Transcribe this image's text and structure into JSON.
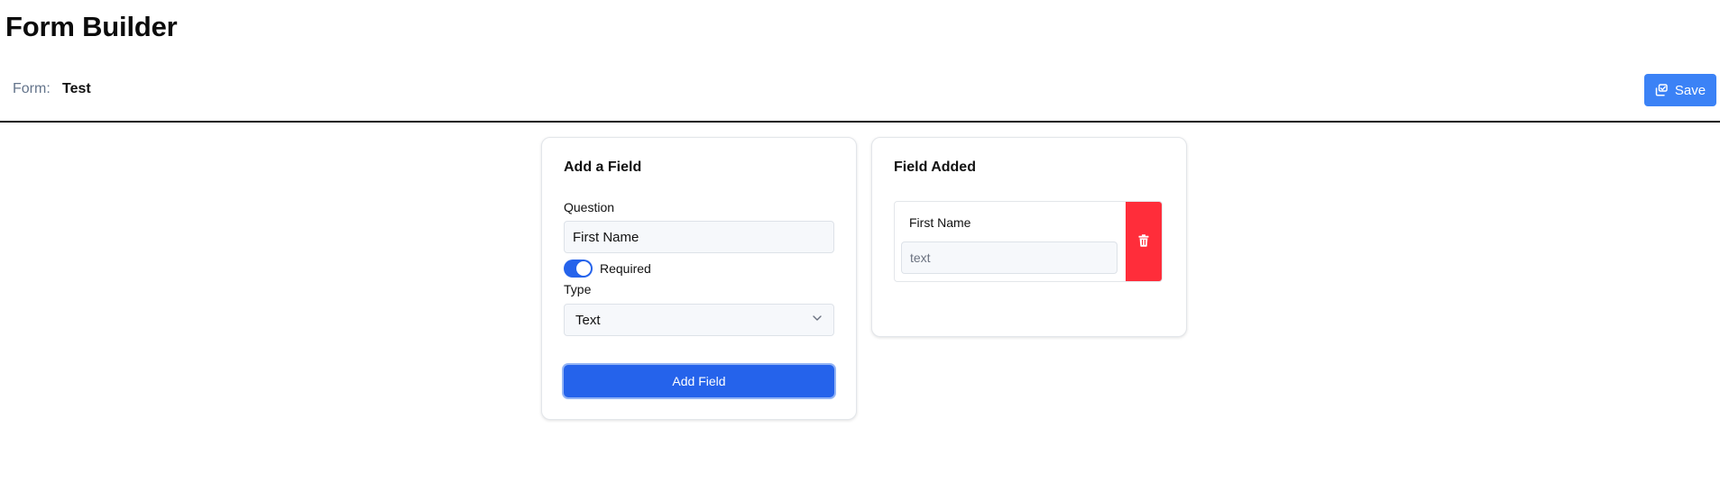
{
  "header": {
    "title": "Form Builder"
  },
  "form_bar": {
    "label": "Form:",
    "name": "Test",
    "save_label": "Save",
    "save_icon": "save-icon"
  },
  "add_field_card": {
    "title": "Add a Field",
    "question_label": "Question",
    "question_value": "First Name",
    "required_label": "Required",
    "required_on": true,
    "type_label": "Type",
    "type_value": "Text",
    "submit_label": "Add Field"
  },
  "fields_card": {
    "title": "Field Added",
    "fields": [
      {
        "label": "First Name",
        "placeholder": "text",
        "delete_icon": "trash-icon"
      }
    ]
  },
  "colors": {
    "primary": "#2563eb",
    "save_button": "#3b82f6",
    "danger": "#ff2d3a"
  }
}
